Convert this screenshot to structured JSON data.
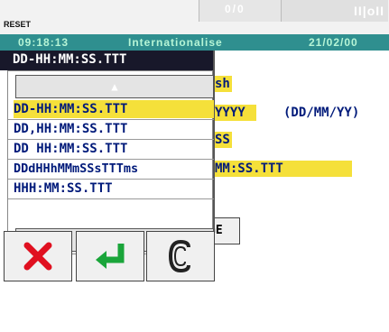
{
  "header": {
    "reset_label": "RESET",
    "center_value": "0/0",
    "alarm_icon_text": "II|oII"
  },
  "status_bar": {
    "time": "09:18:13",
    "title": "Internationalise",
    "date": "21/02/00"
  },
  "background": {
    "language_fragment": "sh",
    "date_format_fragment": "YYYY",
    "date_format_hint": "(DD/MM/YY)",
    "short_fragment": "SS",
    "time_format_fragment": "MM:SS.TTT",
    "button_fragment": "GE"
  },
  "dropdown": {
    "current_value": "DD-HH:MM:SS.TTT",
    "options": [
      "DD-HH:MM:SS.TTT",
      "DD,HH:MM:SS.TTT",
      "DD HH:MM:SS.TTT",
      "DDdHHhMMmSSsTTTms",
      "HHH:MM:SS.TTT"
    ],
    "selected_index": 0
  },
  "actions": {
    "cancel_icon": "cancel-x-icon",
    "enter_icon": "enter-arrow-icon",
    "copy_icon": "copy-c-icon"
  },
  "colors": {
    "status_bar_bg": "#2f8f8f",
    "status_text": "#b6f5d6",
    "selection": "#f5e03a",
    "text": "#001a7a",
    "title_bg": "#18182a",
    "cancel": "#e01020",
    "enter": "#1aa53a"
  }
}
